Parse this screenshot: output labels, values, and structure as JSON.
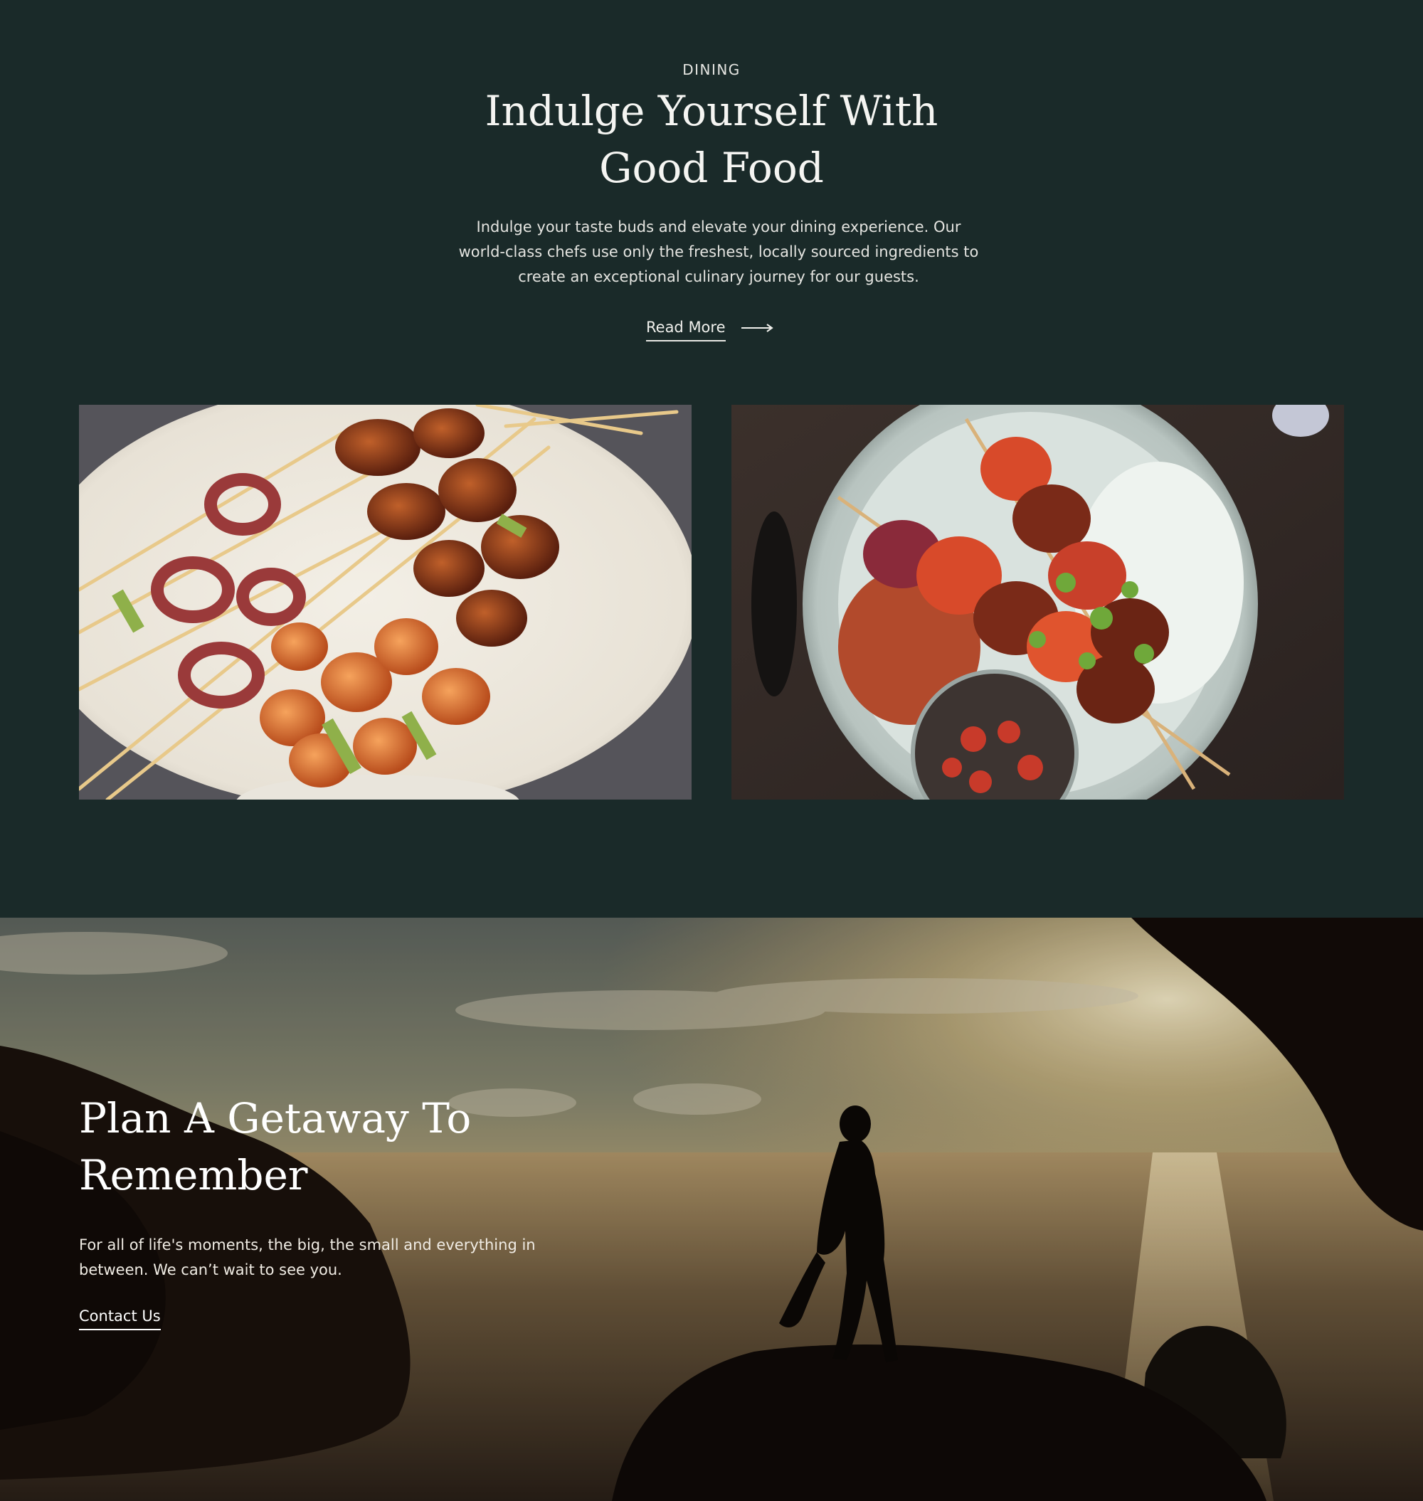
{
  "dining": {
    "eyebrow": "DINING",
    "title_line1": "Indulge Yourself With",
    "title_line2": "Good Food",
    "description_line1": "Indulge your taste buds and elevate your dining experience. Our",
    "description_line2": "world-class chefs use only the freshest, locally sourced ingredients to",
    "description_line3": "create an exceptional culinary journey for our guests.",
    "read_more_label": "Read More",
    "read_more_icon": "arrow-right-icon",
    "images": [
      {
        "subject": "seafood-skewers-photo"
      },
      {
        "subject": "kebab-plate-photo"
      }
    ]
  },
  "getaway": {
    "title_line1": "Plan A Getaway To",
    "title_line2": "Remember",
    "text_line1": "For all of life's moments, the big, the small and everything in",
    "text_line2": "between. We can’t wait to see you.",
    "contact_label": "Contact Us",
    "background": "sunset-coast-photo"
  },
  "colors": {
    "background": "#1a2a29",
    "text": "#f2f2ef"
  }
}
